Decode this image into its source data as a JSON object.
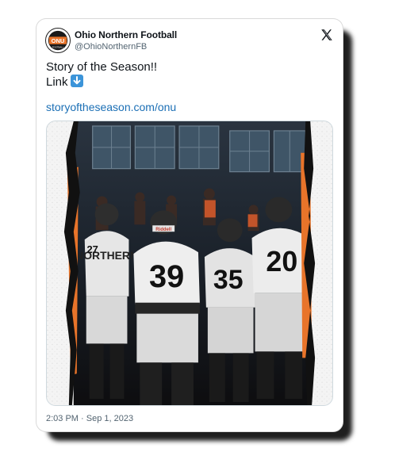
{
  "account": {
    "display_name": "Ohio Northern Football",
    "handle": "@OhioNorthernFB",
    "avatar_text": "ONU",
    "avatar_subtext": "FOOTBALL"
  },
  "post": {
    "lines": [
      "Story of the Season!!",
      "Link"
    ],
    "emoji_icon": "down-arrow-emoji",
    "link_text": "storyoftheseason.com/onu",
    "timestamp": "2:03 PM · Sep 1, 2023"
  },
  "media": {
    "helmet_brand": "Riddell",
    "jersey_numbers": [
      "27",
      "39",
      "35",
      "20"
    ],
    "jersey_text": "NORTHERN"
  },
  "icons": {
    "platform": "x-logo-icon",
    "emoji": "down-arrow-icon"
  },
  "colors": {
    "accent_orange": "#e8742a",
    "link_blue": "#1b6fb5",
    "emoji_blue": "#3b94d9",
    "text_primary": "#0f1419",
    "text_secondary": "#536471"
  }
}
